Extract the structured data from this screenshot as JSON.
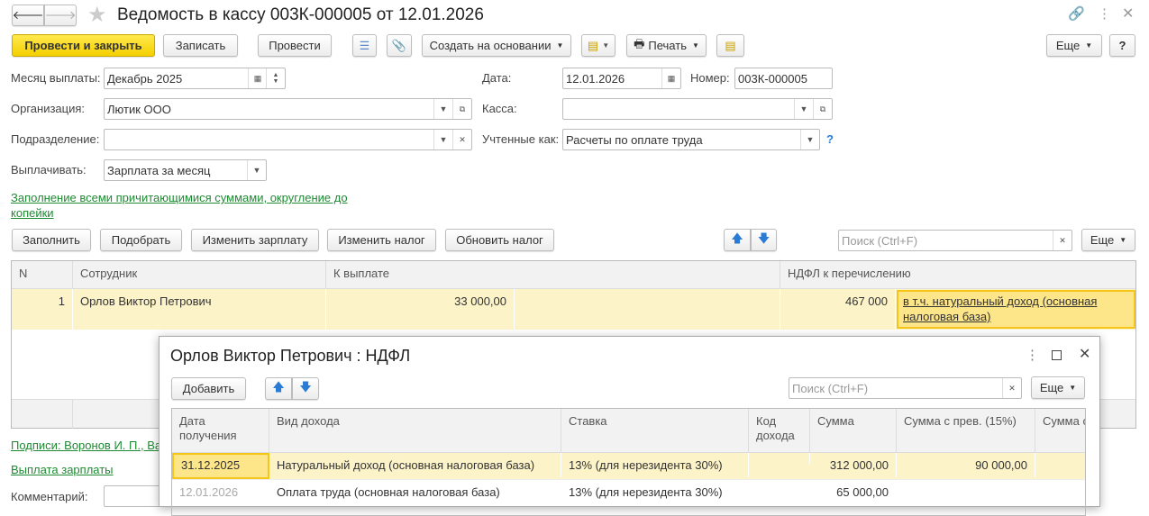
{
  "window": {
    "title": "Ведомость в кассу 003К-000005 от 12.01.2026"
  },
  "toolbar": {
    "post_close": "Провести и закрыть",
    "save": "Записать",
    "post": "Провести",
    "create_based": "Создать на основании",
    "print": "Печать",
    "more": "Еще",
    "help": "?"
  },
  "form": {
    "month_label": "Месяц выплаты:",
    "month_value": "Декабрь 2025",
    "date_label": "Дата:",
    "date_value": "12.01.2026",
    "number_label": "Номер:",
    "number_value": "003К-000005",
    "org_label": "Организация:",
    "org_value": "Лютик ООО",
    "cash_label": "Касса:",
    "cash_value": "",
    "dept_label": "Подразделение:",
    "dept_value": "",
    "accounted_label": "Учтенные как:",
    "accounted_value": "Расчеты по оплате труда",
    "accounted_help": "?",
    "pay_label": "Выплачивать:",
    "pay_value": "Зарплата за месяц",
    "fill_link": "Заполнение всеми причитающимися суммами, округление до копейки"
  },
  "table_toolbar": {
    "fill": "Заполнить",
    "pick": "Подобрать",
    "change_salary": "Изменить зарплату",
    "change_tax": "Изменить налог",
    "update_tax": "Обновить налог",
    "search_placeholder": "Поиск (Ctrl+F)",
    "more": "Еще"
  },
  "table": {
    "headers": [
      "N",
      "Сотрудник",
      "К выплате",
      "НДФЛ к перечислению"
    ],
    "rows": [
      {
        "n": "1",
        "employee": "Орлов Виктор Петрович",
        "to_pay": "33 000,00",
        "ndfl": "467 000",
        "ndfl_link": "в т.ч. натуральный доход (основная налоговая база)"
      }
    ]
  },
  "footer": {
    "signatures": "Подписи: Воронов И. П., Ва",
    "salary_link": "Выплата зарплаты",
    "comment_label": "Комментарий:"
  },
  "modal": {
    "title": "Орлов Виктор Петрович : НДФЛ",
    "add": "Добавить",
    "search_placeholder": "Поиск (Ctrl+F)",
    "more": "Еще",
    "headers": [
      "Дата получения",
      "Вид дохода",
      "Ставка",
      "Код дохода",
      "Сумма",
      "Сумма с прев. (15%)",
      "Сумма с"
    ],
    "rows": [
      {
        "date": "31.12.2025",
        "type": "Натуральный доход (основная налоговая база)",
        "rate": "13% (для нерезидента 30%)",
        "code": "",
        "sum": "312 000,00",
        "sum15": "90 000,00"
      },
      {
        "date": "12.01.2026",
        "type": "Оплата труда (основная налоговая база)",
        "rate": "13% (для нерезидента 30%)",
        "code": "",
        "sum": "65 000,00",
        "sum15": ""
      }
    ]
  },
  "colors": {
    "accent_yellow": "#f4cf00",
    "row_highlight": "#fdf3c8",
    "link_green": "#1e8a32"
  }
}
